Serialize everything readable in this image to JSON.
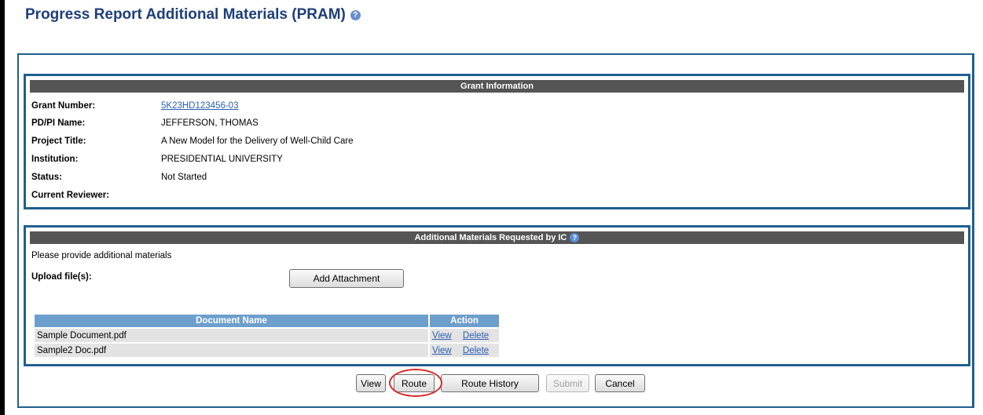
{
  "page": {
    "title": "Progress Report Additional Materials (PRAM)",
    "help_icon": "question-circle-icon"
  },
  "grant_info": {
    "header": "Grant Information",
    "fields": [
      {
        "label": "Grant Number:",
        "value": "5K23HD123456-03",
        "is_link": true
      },
      {
        "label": "PD/PI Name:",
        "value": "JEFFERSON, THOMAS",
        "is_link": false
      },
      {
        "label": "Project Title:",
        "value": "A New Model for the Delivery of Well-Child Care",
        "is_link": false
      },
      {
        "label": "Institution:",
        "value": "PRESIDENTIAL UNIVERSITY",
        "is_link": false
      },
      {
        "label": "Status:",
        "value": "Not Started",
        "is_link": false
      },
      {
        "label": "Current Reviewer:",
        "value": "",
        "is_link": false
      }
    ]
  },
  "materials": {
    "header": "Additional Materials Requested by IC",
    "instructions": "Please provide additional materials",
    "upload_label": "Upload file(s):",
    "add_attachment_label": "Add Attachment",
    "table": {
      "columns": [
        "Document Name",
        "Action"
      ],
      "rows": [
        {
          "name": "Sample Document.pdf",
          "actions": [
            "View",
            "Delete"
          ]
        },
        {
          "name": "Sample2 Doc.pdf",
          "actions": [
            "View",
            "Delete"
          ]
        }
      ]
    }
  },
  "footer_buttons": {
    "view": "View",
    "route": "Route",
    "route_history": "Route History",
    "submit": "Submit",
    "cancel": "Cancel"
  },
  "colors": {
    "title": "#1d3f7a",
    "panel_border": "#1f5f8f",
    "panel_header": "#555555",
    "table_header": "#6d9fcd",
    "link": "#2a5db0",
    "highlight": "#d82a2a"
  }
}
